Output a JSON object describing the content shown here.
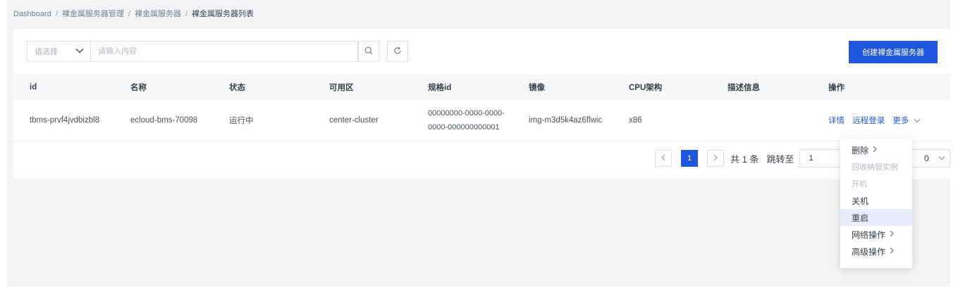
{
  "breadcrumb": {
    "items": [
      "Dashboard",
      "裸金属服务器管理",
      "裸金属服务器"
    ],
    "current": "裸金属服务器列表",
    "separator": "/"
  },
  "filter": {
    "select_placeholder": "请选择",
    "search_placeholder": "请输入内容"
  },
  "toolbar": {
    "create_label": "创建裸金属服务器"
  },
  "table": {
    "columns": [
      "id",
      "名称",
      "状态",
      "可用区",
      "规格id",
      "镜像",
      "CPU架构",
      "描述信息",
      "操作"
    ],
    "rows": [
      {
        "id": "tbms-prvf4jvdbizbl8",
        "name": "ecloud-bms-70098",
        "status": "运行中",
        "zone": "center-cluster",
        "spec_line1": "00000000-0000-0000-",
        "spec_line2": "0000-000000000001",
        "image": "img-m3d5k4az6flwic",
        "cpu": "x86",
        "desc": "",
        "action_detail": "详情",
        "action_remote": "远程登录",
        "action_more": "更多"
      }
    ]
  },
  "pagination": {
    "current_page": "1",
    "total_text": "共 1 条",
    "jump_label": "跳转至",
    "jump_value": "1",
    "page_size_partial": "0"
  },
  "more_menu": {
    "items": [
      {
        "label": "删除",
        "submenu": true,
        "disabled": false
      },
      {
        "label": "回收纳管实例",
        "submenu": false,
        "disabled": true
      },
      {
        "label": "开机",
        "submenu": false,
        "disabled": true
      },
      {
        "label": "关机",
        "submenu": false,
        "disabled": false
      },
      {
        "label": "重启",
        "submenu": false,
        "disabled": false,
        "hover": true
      },
      {
        "label": "网络操作",
        "submenu": true,
        "disabled": false
      },
      {
        "label": "高级操作",
        "submenu": true,
        "disabled": false
      }
    ]
  },
  "colors": {
    "primary": "#1f56e0",
    "background": "#f2f3f5",
    "hover": "#e8eefc"
  }
}
